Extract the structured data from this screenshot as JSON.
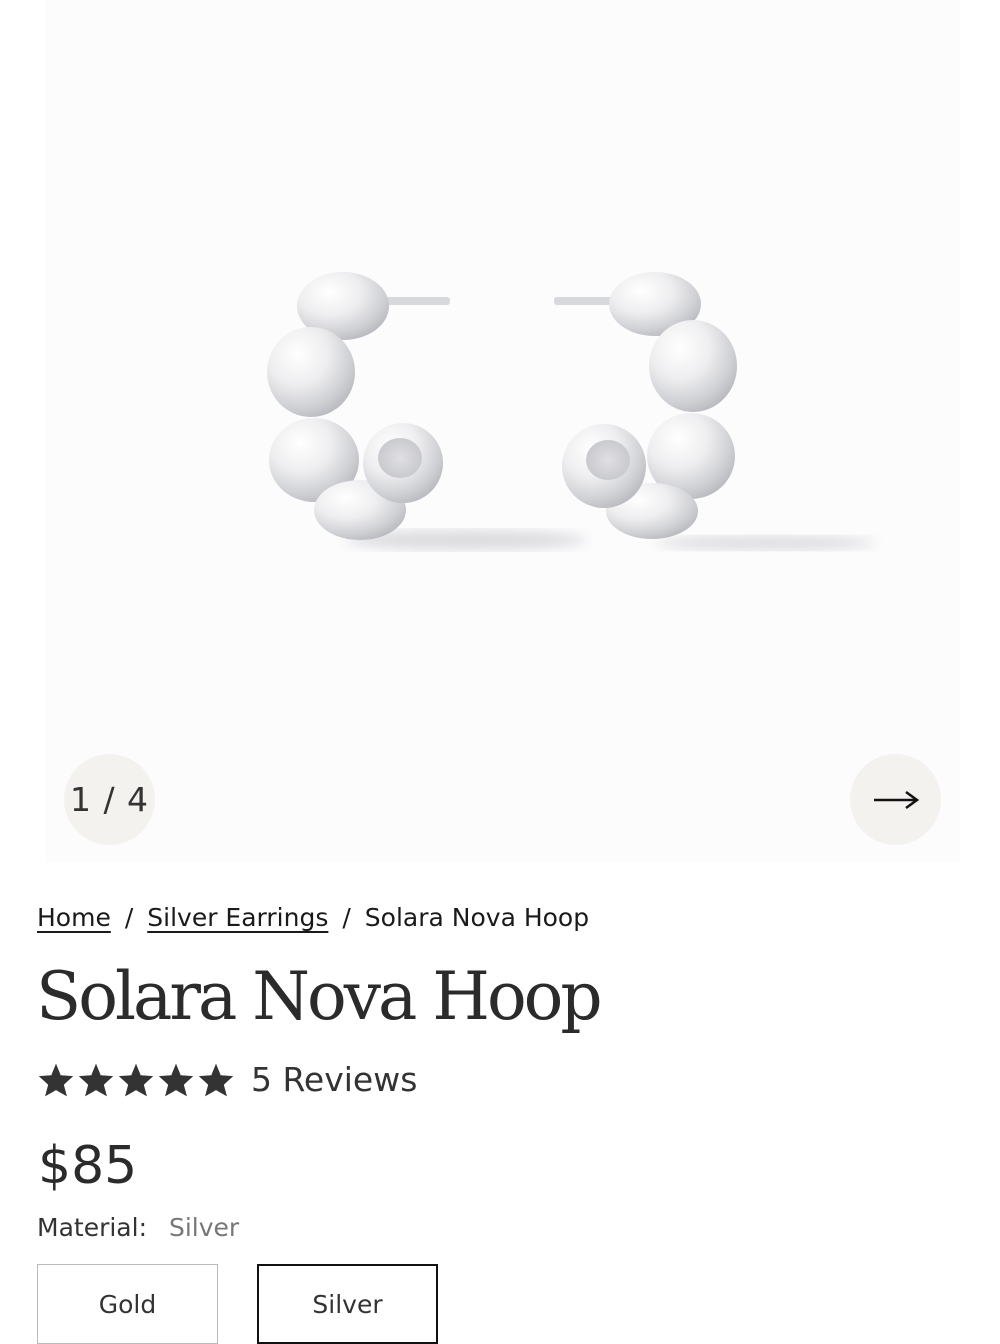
{
  "gallery": {
    "counter": "1 / 4",
    "image_alt": "Solara Nova Hoop silver earrings",
    "next_icon": "arrow-right-icon"
  },
  "breadcrumb": {
    "home": "Home",
    "separator": "/",
    "category": "Silver Earrings",
    "current": "Solara Nova Hoop"
  },
  "product": {
    "title": "Solara Nova Hoop",
    "rating": 5,
    "rating_icon": "star-icon",
    "reviews_label": "5 Reviews",
    "price": "$85",
    "material_label": "Material:",
    "material_value": "Silver",
    "options": [
      "Gold",
      "Silver"
    ],
    "selected_option": "Silver"
  },
  "colors": {
    "text_dark": "#222222",
    "star": "#333333",
    "button_bg": "#f4f2ee",
    "selected_border": "#111111",
    "metal": "#e6e6e8"
  }
}
